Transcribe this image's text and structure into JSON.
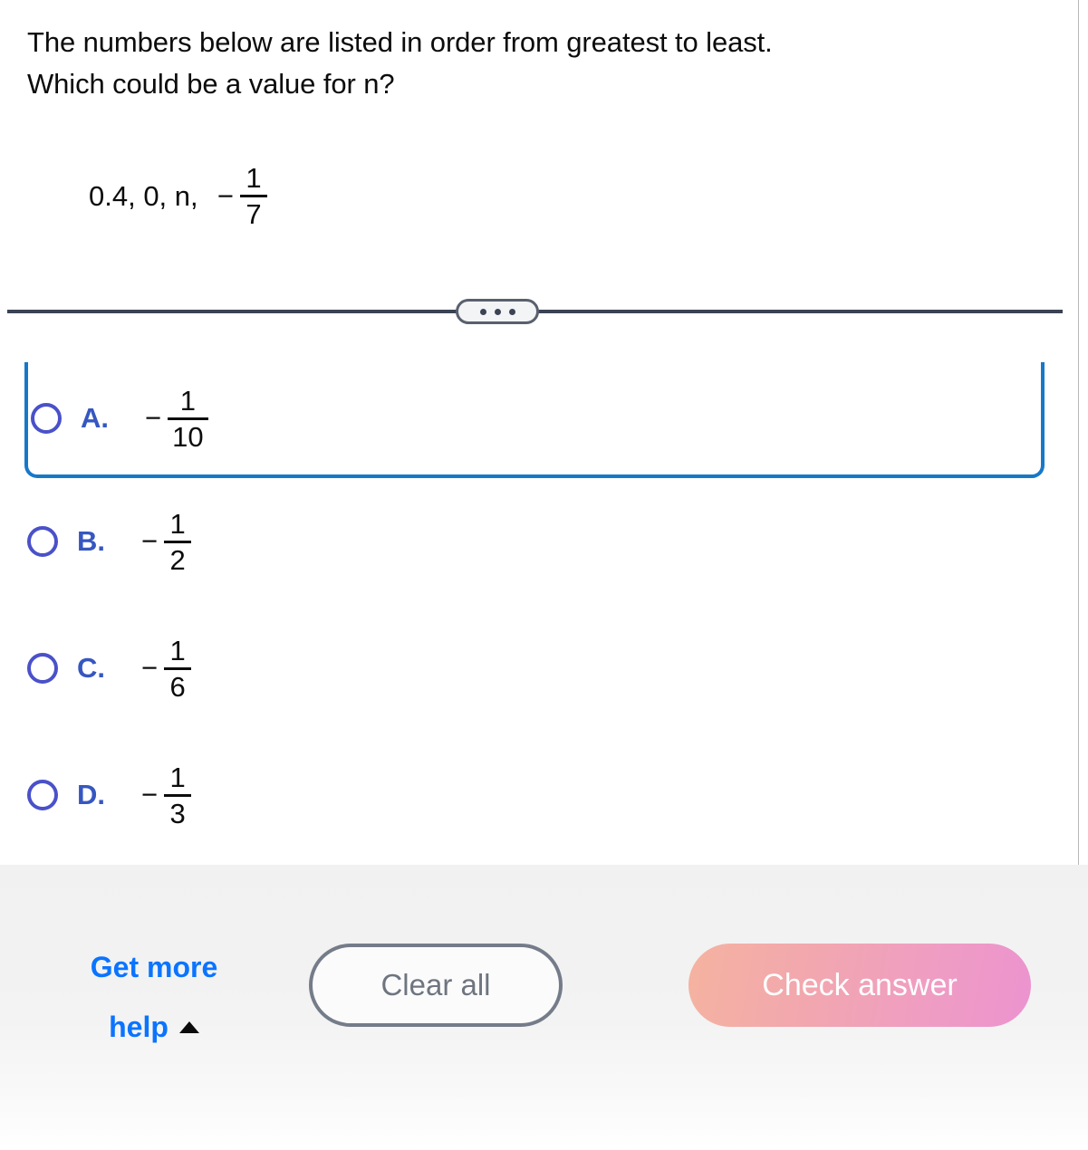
{
  "question": {
    "prompt_line1": "The numbers below are listed in order from greatest to least.",
    "prompt_line2": "Which could be a value for n?",
    "expression": {
      "lead": "0.4, 0, n,  ",
      "minus": "−",
      "numerator": "1",
      "denominator": "7"
    }
  },
  "divider": {
    "dots_label": "•••"
  },
  "choices": [
    {
      "letter": "A.",
      "minus": "−",
      "numerator": "1",
      "denominator": "10",
      "focused": true
    },
    {
      "letter": "B.",
      "minus": "−",
      "numerator": "1",
      "denominator": "2",
      "focused": false
    },
    {
      "letter": "C.",
      "minus": "−",
      "numerator": "1",
      "denominator": "6",
      "focused": false
    },
    {
      "letter": "D.",
      "minus": "−",
      "numerator": "1",
      "denominator": "3",
      "focused": false
    }
  ],
  "footer": {
    "get_more_help_line1": "Get more",
    "get_more_help_line2": "help",
    "clear_all_label": "Clear all",
    "check_answer_label": "Check answer"
  },
  "colors": {
    "focus_border": "#1878c8",
    "radio_ring": "#4a51c9",
    "choice_letter": "#3657c0",
    "help_link": "#0a74ff",
    "clear_all_border": "#757c89",
    "check_gradient_start": "#f5b3a0",
    "check_gradient_end": "#ec93cf",
    "divider": "#3b4354",
    "text": "#0c0c0c"
  }
}
